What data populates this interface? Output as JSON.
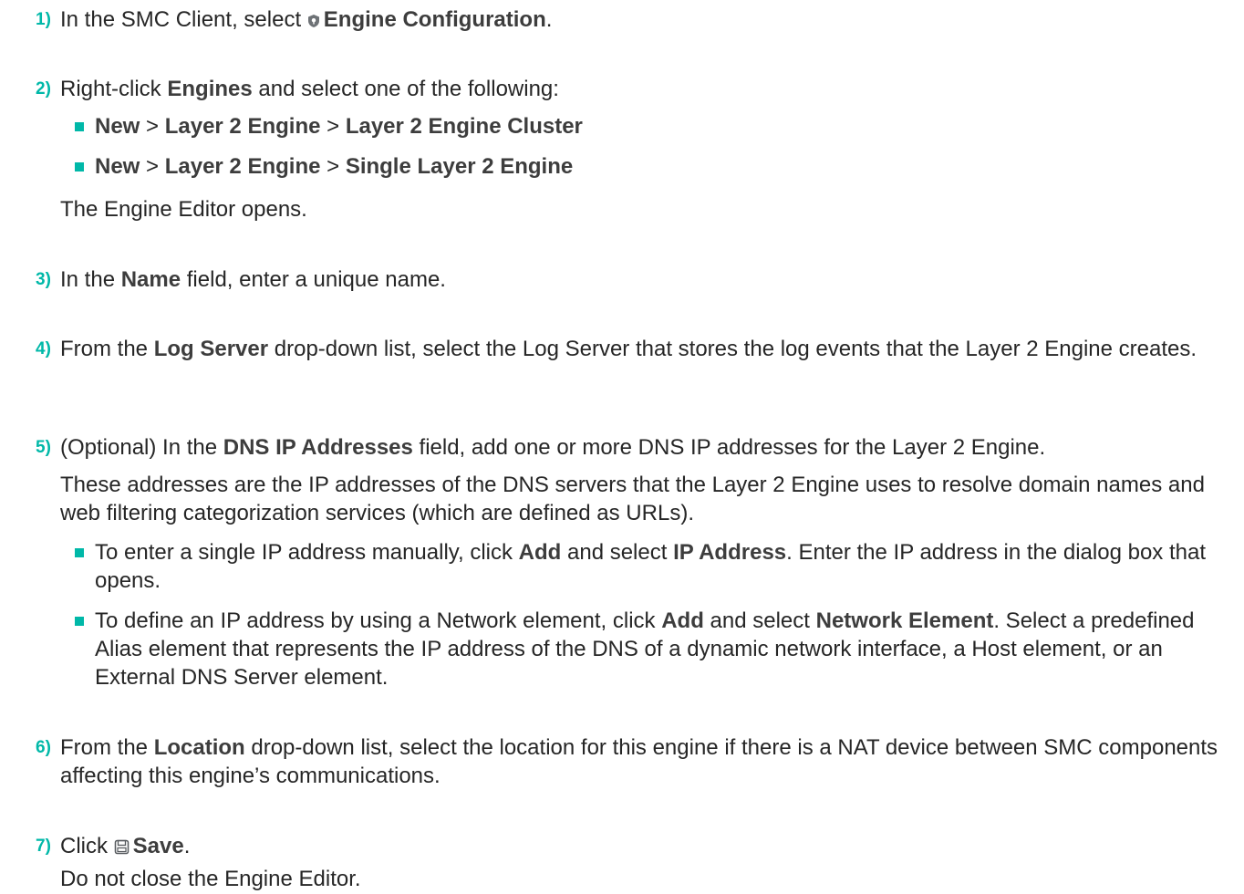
{
  "steps": [
    {
      "number": "1)",
      "parts": [
        "In the SMC Client, select ",
        "Engine Configuration",
        "."
      ],
      "icon": "shield-icon"
    },
    {
      "number": "2)",
      "parts": [
        "Right-click ",
        "Engines",
        " and select one of the following:"
      ],
      "options": [
        {
          "new": "New",
          "sep1": " > ",
          "layer": "Layer 2 Engine",
          "sep2": " > ",
          "target": "Layer 2 Engine Cluster"
        },
        {
          "new": "New",
          "sep1": " > ",
          "layer": "Layer 2 Engine",
          "sep2": " > ",
          "target": "Single Layer 2 Engine"
        }
      ],
      "result": "The Engine Editor opens."
    },
    {
      "number": "3)",
      "parts": [
        "In the ",
        "Name",
        " field, enter a unique name."
      ]
    },
    {
      "number": "4)",
      "parts": [
        "From the ",
        "Log Server",
        " drop-down list, select the Log Server that stores the log events that the Layer 2 Engine creates."
      ]
    },
    {
      "number": "5)",
      "parts": [
        "(Optional) In the ",
        "DNS IP Addresses",
        " field, add one or more DNS IP addresses for the Layer 2 Engine."
      ],
      "explanation": "These addresses are the IP addresses of the DNS servers that the Layer 2 Engine uses to resolve domain names and web filtering categorization services (which are defined as URLs).",
      "bullets": [
        {
          "a": "To enter a single IP address manually, click ",
          "b": "Add",
          "c": " and select ",
          "d": "IP Address",
          "e": ". Enter the IP address in the dialog box that opens."
        },
        {
          "a": "To define an IP address by using a Network element, click ",
          "b": "Add",
          "c": " and select ",
          "d": "Network Element",
          "e": ". Select a predefined Alias element that represents the IP address of the DNS of a dynamic network interface, a Host element, or an External DNS Server element."
        }
      ]
    },
    {
      "number": "6)",
      "parts": [
        "From the ",
        "Location",
        " drop-down list, select the location for this engine if there is a NAT device between SMC components affecting this engine’s communications."
      ]
    },
    {
      "number": "7)",
      "parts": [
        "Click ",
        "Save",
        "."
      ],
      "icon": "save-icon",
      "result": "Do not close the Engine Editor."
    }
  ],
  "colors": {
    "accent": "#00b8a8",
    "text": "#262626"
  }
}
